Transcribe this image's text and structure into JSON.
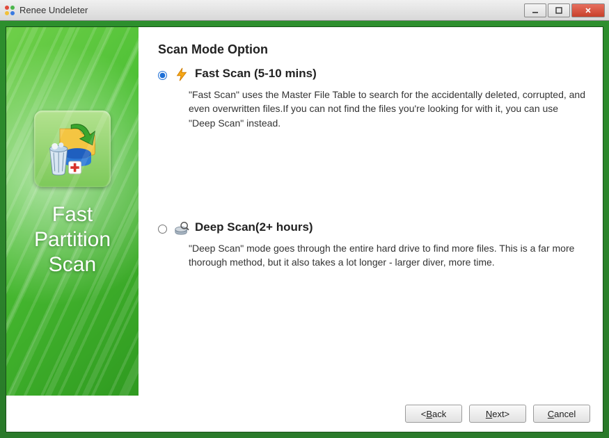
{
  "window": {
    "title": "Renee Undeleter"
  },
  "sidebar": {
    "title": "Fast\nPartition\nScan"
  },
  "main": {
    "heading": "Scan Mode Option",
    "options": [
      {
        "id": "fast",
        "selected": true,
        "label": "Fast Scan (5-10 mins)",
        "description": "\"Fast Scan\" uses the Master File Table to search for the accidentally deleted, corrupted, and even overwritten files.If you can not find the files you're looking for with it, you can use \"Deep Scan\" instead."
      },
      {
        "id": "deep",
        "selected": false,
        "label": "Deep Scan(2+ hours)",
        "description": "\"Deep Scan\" mode goes through the entire hard drive to find more files. This is a far more thorough method, but it also takes a lot longer - larger diver, more time."
      }
    ]
  },
  "footer": {
    "back": "<Back",
    "next": "Next>",
    "cancel": "Cancel"
  }
}
